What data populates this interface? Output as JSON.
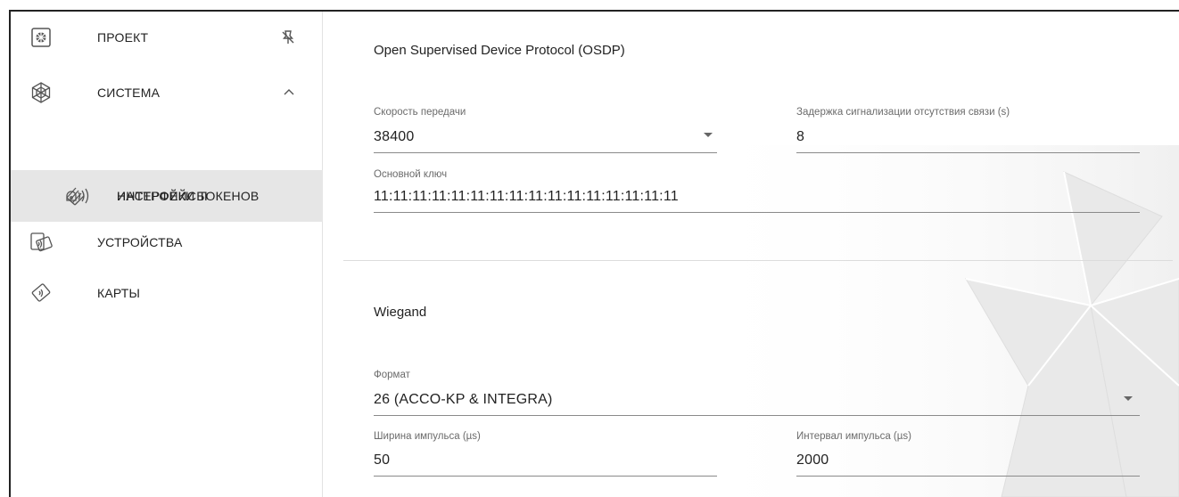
{
  "sidebar": {
    "items": [
      {
        "label": "ПРОЕКТ",
        "icon": "gear-icon",
        "end_icon": "pin-off-icon",
        "active": false
      },
      {
        "label": "СИСТЕМА",
        "icon": "snowflake-icon",
        "end_icon": "chevron-up-icon",
        "active": false
      },
      {
        "label": "ИНТЕРФЕЙСЫ",
        "icon": "interfaces-icon",
        "active": true
      },
      {
        "label": "НАСТРОЙКИ ТОКЕНОВ",
        "icon": "token-wireless-icon",
        "active": false
      },
      {
        "label": "УСТРОЙСТВА",
        "icon": "card-reader-icon",
        "active": false
      },
      {
        "label": "КАРТЫ",
        "icon": "card-icon",
        "active": false
      }
    ]
  },
  "osdp": {
    "title": "Open Supervised Device Protocol (OSDP)",
    "baud": {
      "label": "Скорость передачи",
      "value": "38400"
    },
    "delay": {
      "label": "Задержка сигнализации отсутствия связи (s)",
      "value": "8"
    },
    "key": {
      "label": "Основной ключ",
      "value": "11:11:11:11:11:11:11:11:11:11:11:11:11:11:11:11"
    }
  },
  "wiegand": {
    "title": "Wiegand",
    "format": {
      "label": "Формат",
      "value": "26 (ACCO-KP & INTEGRA)"
    },
    "pulse_width": {
      "label": "Ширина импульса (µs)",
      "value": "50"
    },
    "pulse_interval": {
      "label": "Интервал импульса (µs)",
      "value": "2000"
    }
  }
}
